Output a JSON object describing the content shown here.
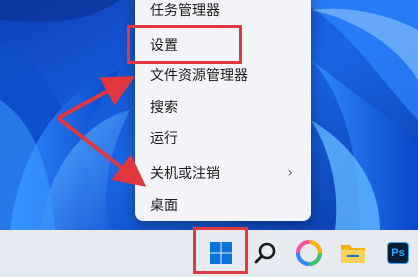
{
  "context_menu": {
    "items": [
      {
        "label": "任务管理器",
        "name": "menu-item-task-manager"
      },
      {
        "label": "设置",
        "name": "menu-item-settings"
      },
      {
        "label": "文件资源管理器",
        "name": "menu-item-file-explorer"
      },
      {
        "label": "搜索",
        "name": "menu-item-search"
      },
      {
        "label": "运行",
        "name": "menu-item-run"
      },
      {
        "label": "关机或注销",
        "name": "menu-item-shutdown-signout",
        "has_submenu": true
      },
      {
        "label": "桌面",
        "name": "menu-item-desktop"
      }
    ],
    "submenu_chevron": "›"
  },
  "taskbar": {
    "icons": [
      "windows-start-icon",
      "search-icon",
      "photos-icon",
      "file-explorer-icon",
      "photoshop-icon"
    ],
    "photoshop_text": "Ps"
  },
  "annotation": {
    "highlight_color": "#e0383e"
  },
  "colors": {
    "wallpaper_blue": "#1560e0",
    "menu_background": "#f3f4f7",
    "taskbar_background": "#e7eaf1",
    "windows_blue": "#0a74da"
  }
}
